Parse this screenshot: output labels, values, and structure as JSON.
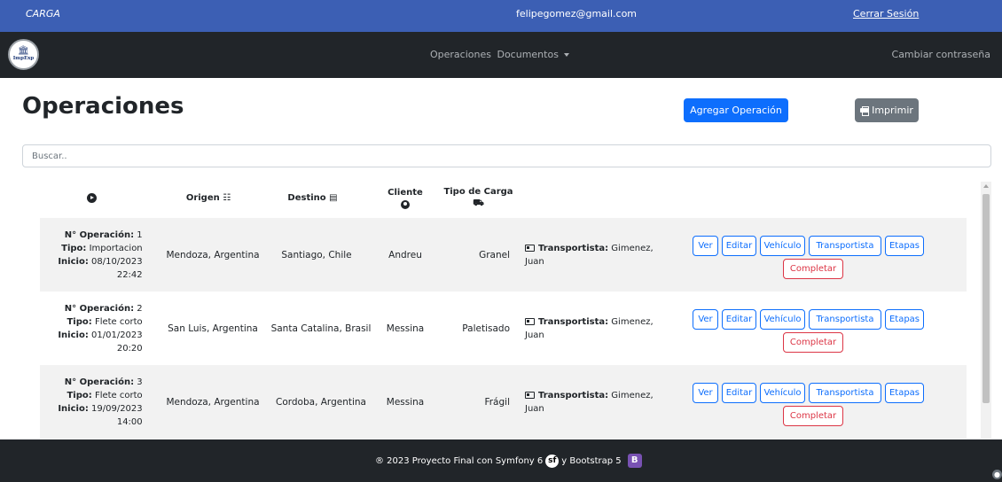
{
  "topbar": {
    "role": "CARGA",
    "email": "felipegomez@gmail.com",
    "logout": "Cerrar Sesión"
  },
  "navbar": {
    "logo_text": "ImpExp",
    "links": [
      "Operaciones",
      "Documentos"
    ],
    "right_link": "Cambiar contraseña"
  },
  "page": {
    "title": "Operaciones",
    "add_button": "Agregar Operación",
    "print_button": "Imprimir",
    "search_placeholder": "Buscar.."
  },
  "table": {
    "headers": {
      "origen": "Origen",
      "destino": "Destino",
      "cliente": "Cliente",
      "tipo_carga_1": "Tipo de Carga"
    },
    "labels": {
      "op_number": "N° Operación:",
      "tipo": "Tipo:",
      "inicio": "Inicio:",
      "transportista": "Transportista:"
    },
    "actions": {
      "ver": "Ver",
      "editar": "Editar",
      "vehiculo": "Vehículo",
      "transportista": "Transportista",
      "etapas": "Etapas",
      "completar": "Completar"
    },
    "rows": [
      {
        "num": " 1",
        "tipo": " Importacion",
        "inicio": " 08/10/2023",
        "hora": "22:42",
        "origen": "Mendoza, Argentina",
        "destino": "Santiago, Chile",
        "cliente": "Andreu",
        "carga": "Granel",
        "transportista_1": " Gimenez,",
        "transportista_2": "Juan"
      },
      {
        "num": " 2",
        "tipo": " Flete corto",
        "inicio": " 01/01/2023",
        "hora": "20:20",
        "origen": "San Luis, Argentina",
        "destino": "Santa Catalina, Brasil",
        "cliente": "Messina",
        "carga": "Paletisado",
        "transportista_1": " Gimenez,",
        "transportista_2": "Juan"
      },
      {
        "num": " 3",
        "tipo": " Flete corto",
        "inicio": " 19/09/2023",
        "hora": "14:00",
        "origen": "Mendoza, Argentina",
        "destino": "Cordoba, Argentina",
        "cliente": "Messina",
        "carga": "Frágil",
        "transportista_1": " Gimenez,",
        "transportista_2": "Juan"
      }
    ]
  },
  "footer": {
    "text_1": "® 2023 Proyecto Final con Symfony 6",
    "text_2": "y Bootstrap 5",
    "symfony_glyph": "sf",
    "bootstrap_glyph": "B"
  },
  "colors": {
    "topbar": "#3c5fb4",
    "navbar": "#212529",
    "primary": "#0d6efd",
    "danger": "#dc3545",
    "secondary": "#6c757d"
  }
}
